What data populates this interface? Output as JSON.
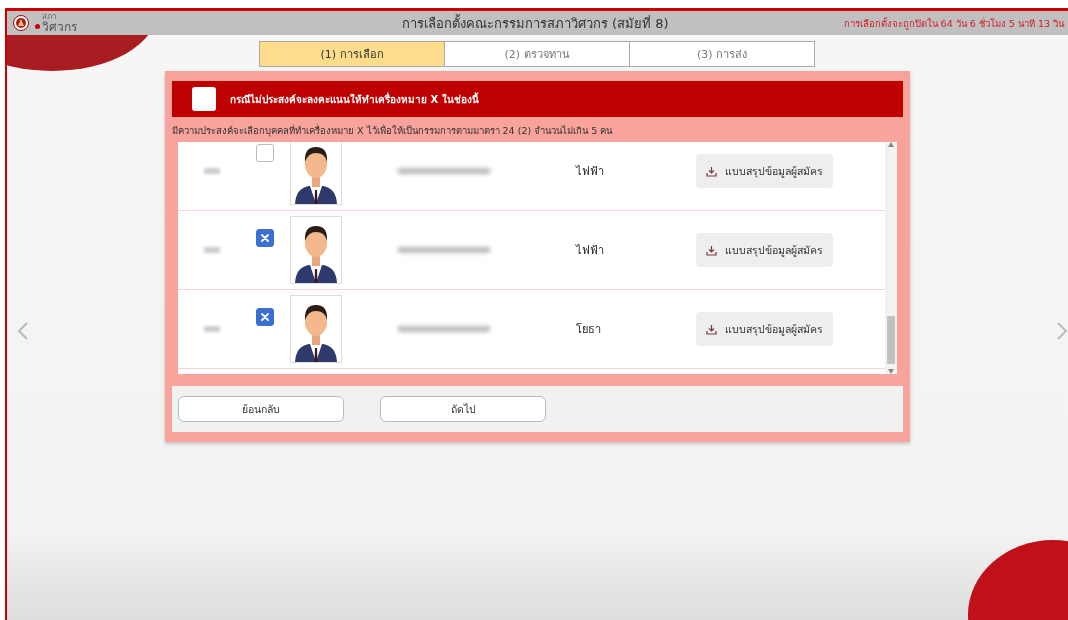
{
  "header": {
    "logo_small": "สภา",
    "logo_text": "วิศวกร",
    "title": "การเลือกตั้งคณะกรรมการสภาวิศวกร (สมัยที่ 8)",
    "countdown": "การเลือกตั้งจะถูกปิดใน 64 วัน 6 ชั่วโมง 5 นาที 13 วิน"
  },
  "steps": [
    {
      "label": "(1) การเลือก",
      "selected": true
    },
    {
      "label": "(2) ตรวจทาน",
      "selected": false
    },
    {
      "label": "(3) การส่ง",
      "selected": false
    }
  ],
  "abstain": {
    "checked": false,
    "label": "กรณีไม่ประสงค์จะลงคะแนนให้ทำเครื่องหมาย X ในช่องนี้"
  },
  "instruction": "มีความประสงค์จะเลือกบุคคลที่ทำเครื่องหมาย X ไว้เพื่อให้เป็นกรรมการตามมาตรา 24 (2) จำนวนไม่เกิน 5 คน",
  "candidates": [
    {
      "checked": false,
      "branch": "ไฟฟ้า",
      "download": "แบบสรุปข้อมูลผู้สมัคร"
    },
    {
      "checked": true,
      "branch": "ไฟฟ้า",
      "download": "แบบสรุปข้อมูลผู้สมัคร"
    },
    {
      "checked": true,
      "branch": "โยธา",
      "download": "แบบสรุปข้อมูลผู้สมัคร"
    }
  ],
  "buttons": [
    {
      "label": "ย้อนกลับ"
    },
    {
      "label": "ถัดไป"
    }
  ]
}
